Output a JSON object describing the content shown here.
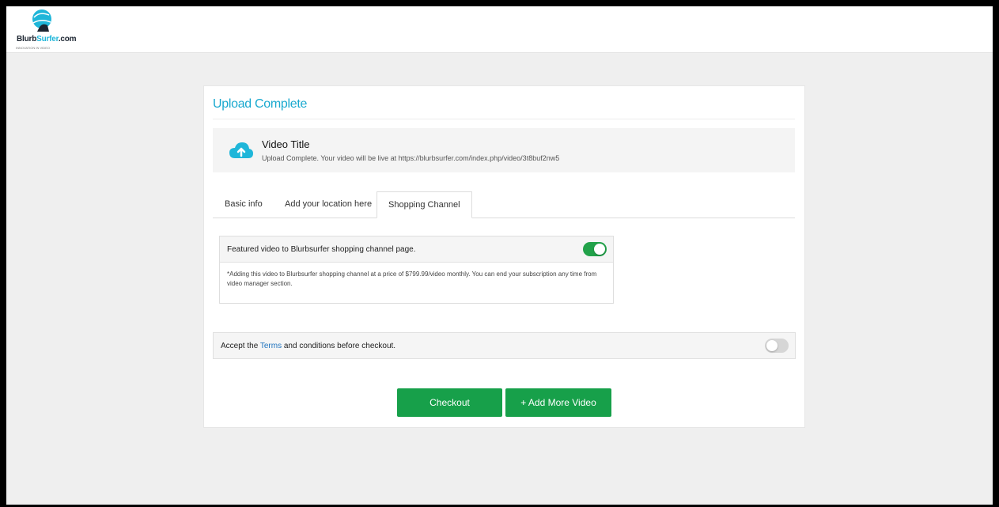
{
  "brand": {
    "name_dark": "Blurb",
    "name_accent": "Surfer",
    "name_suffix": ".com",
    "tagline": "INNOVATION IN VIDEO",
    "accent_color": "#1fb6d9"
  },
  "upload": {
    "heading": "Upload Complete",
    "icon": "cloud-upload-icon",
    "video_title": "Video Title",
    "status_message": "Upload Complete. Your video will be live at https://blurbsurfer.com/index.php/video/3t8buf2nw5"
  },
  "tabs": [
    {
      "label": "Basic info",
      "active": false
    },
    {
      "label": "Add your location here",
      "active": false
    },
    {
      "label": "Shopping Channel",
      "active": true
    }
  ],
  "featured": {
    "label": "Featured video to Blurbsurfer shopping channel page.",
    "enabled": true,
    "note": "*Adding this video to Blurbsurfer shopping channel at a price of $799.99/video monthly. You can end your subscription any time from video manager section."
  },
  "terms": {
    "prefix": "Accept the ",
    "link": "Terms",
    "suffix": " and conditions before checkout.",
    "accepted": false
  },
  "actions": {
    "checkout_label": "Checkout",
    "add_more_label": "+ Add More Video",
    "button_color": "#17a04a"
  }
}
